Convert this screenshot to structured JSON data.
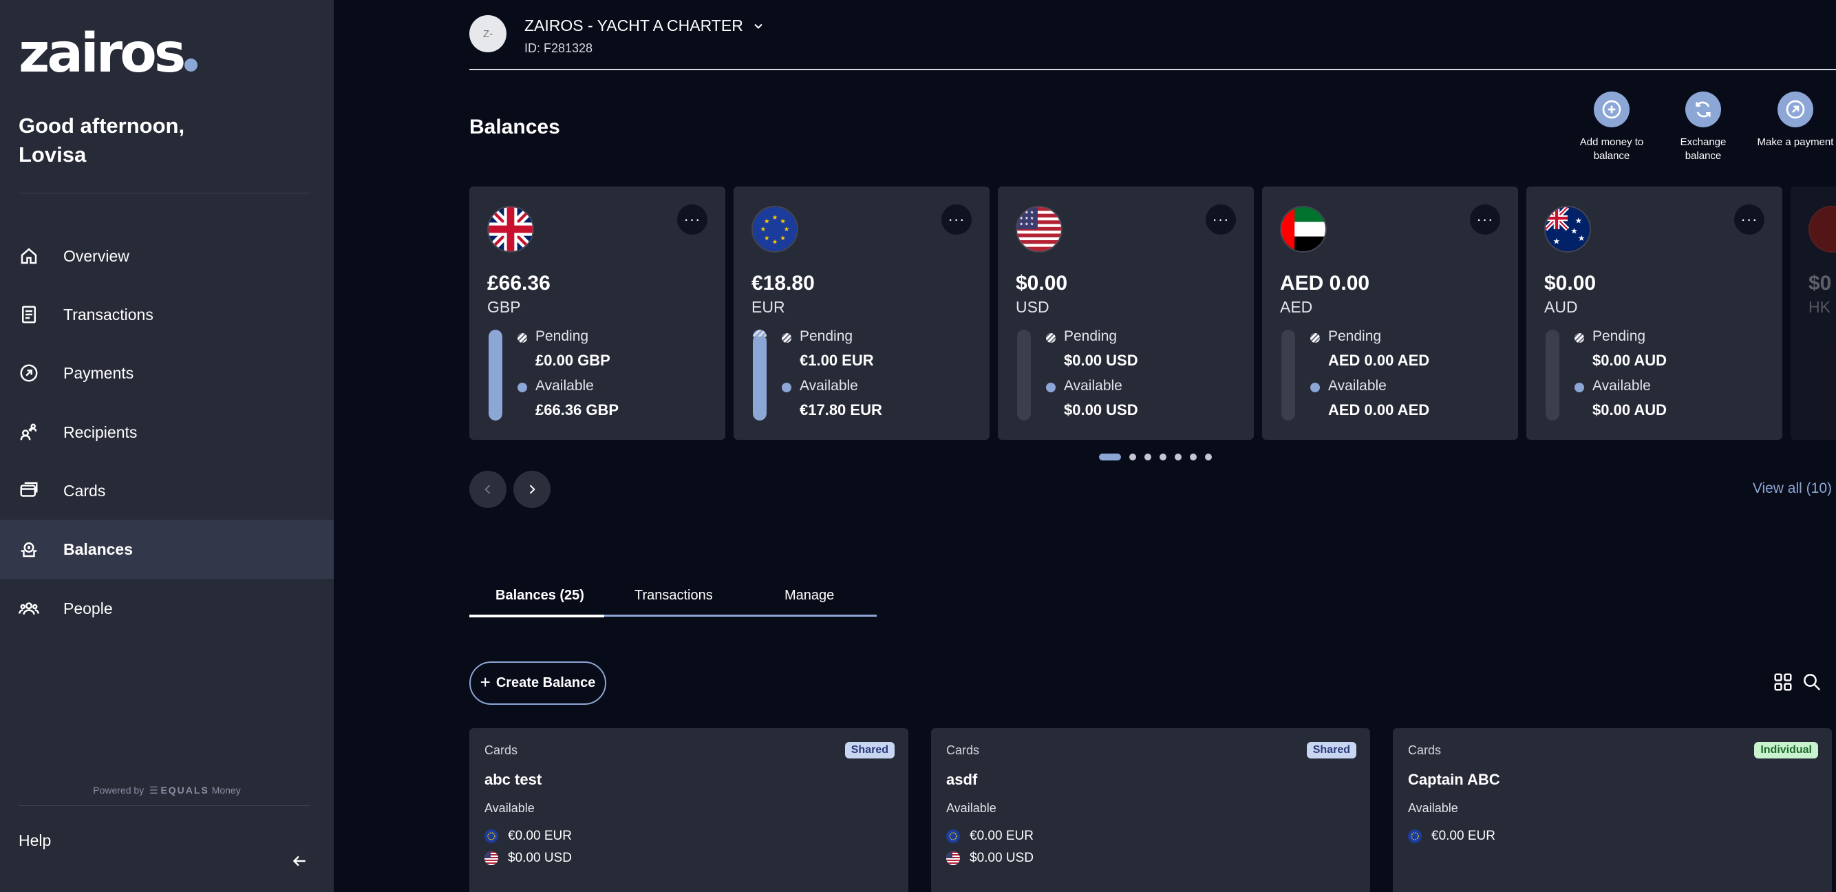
{
  "sidebar": {
    "logo": "zairos",
    "greeting_line1": "Good afternoon,",
    "greeting_line2": "Lovisa",
    "nav": [
      {
        "label": "Overview",
        "icon": "home-icon"
      },
      {
        "label": "Transactions",
        "icon": "document-icon"
      },
      {
        "label": "Payments",
        "icon": "payment-arrow-icon"
      },
      {
        "label": "Recipients",
        "icon": "recipients-icon"
      },
      {
        "label": "Cards",
        "icon": "card-icon"
      },
      {
        "label": "Balances",
        "icon": "balance-icon",
        "active": true
      },
      {
        "label": "People",
        "icon": "people-icon"
      }
    ],
    "powered_by": "Powered by",
    "powered_brand": "EQUALS",
    "powered_brand_suffix": "Money",
    "help": "Help"
  },
  "account": {
    "avatar": "Z-",
    "name": "ZAIROS - YACHT A CHARTER",
    "id": "ID: F281328"
  },
  "page_title": "Balances",
  "quick_actions": [
    {
      "label_line1": "Add money to",
      "label_line2": "balance",
      "icon": "plus-circle-icon"
    },
    {
      "label_line1": "Exchange",
      "label_line2": "balance",
      "icon": "exchange-icon"
    },
    {
      "label_line1": "Make a payment",
      "label_line2": "",
      "icon": "payment-arrow-icon"
    }
  ],
  "currency_cards": [
    {
      "flag": "uk-flag-icon",
      "amount": "£66.36",
      "code": "GBP",
      "pending_label": "Pending",
      "pending": "£0.00 GBP",
      "available_label": "Available",
      "available": "£66.36 GBP",
      "available_fraction": 1.0,
      "pending_fraction": 0.0
    },
    {
      "flag": "eu-flag-icon",
      "amount": "€18.80",
      "code": "EUR",
      "pending_label": "Pending",
      "pending": "€1.00 EUR",
      "available_label": "Available",
      "available": "€17.80 EUR",
      "available_fraction": 0.947,
      "pending_fraction": 0.053
    },
    {
      "flag": "us-flag-icon",
      "amount": "$0.00",
      "code": "USD",
      "pending_label": "Pending",
      "pending": "$0.00 USD",
      "available_label": "Available",
      "available": "$0.00 USD",
      "available_fraction": 0.0,
      "pending_fraction": 0.0
    },
    {
      "flag": "uae-flag-icon",
      "amount": "AED 0.00",
      "code": "AED",
      "pending_label": "Pending",
      "pending": "AED 0.00 AED",
      "available_label": "Available",
      "available": "AED 0.00 AED",
      "available_fraction": 0.0,
      "pending_fraction": 0.0
    },
    {
      "flag": "au-flag-icon",
      "amount": "$0.00",
      "code": "AUD",
      "pending_label": "Pending",
      "pending": "$0.00 AUD",
      "available_label": "Available",
      "available": "$0.00 AUD",
      "available_fraction": 0.0,
      "pending_fraction": 0.0
    },
    {
      "flag": "hk-flag-icon",
      "amount": "$0",
      "code": "HK",
      "partial": true
    }
  ],
  "pager": {
    "count": 7,
    "active": 0
  },
  "view_all": "View all (10)",
  "tabs": [
    {
      "label": "Balances (25)",
      "active": true
    },
    {
      "label": "Transactions"
    },
    {
      "label": "Manage"
    }
  ],
  "create_balance": "Create Balance",
  "balance_tiles": [
    {
      "type": "Cards",
      "name": "abc test",
      "badge": "Shared",
      "badge_kind": "shared",
      "available_label": "Available",
      "lines": [
        {
          "flag": "eu-flag-icon",
          "value": "€0.00 EUR"
        },
        {
          "flag": "us-flag-icon",
          "value": "$0.00 USD"
        }
      ]
    },
    {
      "type": "Cards",
      "name": "asdf",
      "badge": "Shared",
      "badge_kind": "shared",
      "available_label": "Available",
      "lines": [
        {
          "flag": "eu-flag-icon",
          "value": "€0.00 EUR"
        },
        {
          "flag": "us-flag-icon",
          "value": "$0.00 USD"
        }
      ]
    },
    {
      "type": "Cards",
      "name": "Captain ABC",
      "badge": "Individual",
      "badge_kind": "individual",
      "available_label": "Available",
      "lines": [
        {
          "flag": "eu-flag-icon",
          "value": "€0.00 EUR"
        }
      ]
    }
  ],
  "colors": {
    "accent": "#8ca6d6",
    "sidebar": "#272a37",
    "background": "#080b18",
    "card": "#272a37"
  }
}
